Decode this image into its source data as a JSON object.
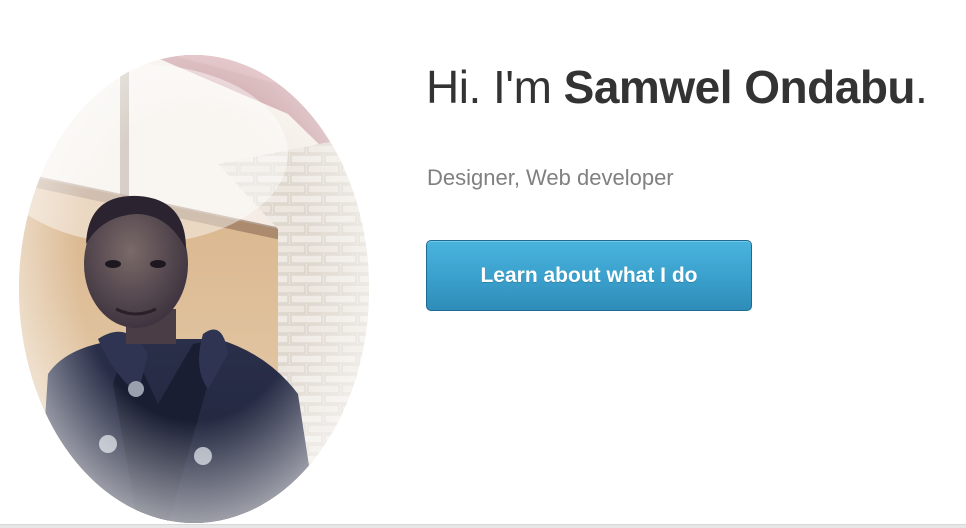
{
  "hero": {
    "greeting": "Hi. I'm ",
    "name": "Samwel Ondabu",
    "period": ".",
    "subtitle": "Designer, Web developer",
    "cta_label": "Learn about what I do"
  },
  "portrait": {
    "shape": "oval"
  },
  "colors": {
    "heading": "#333333",
    "subtitle": "#808080",
    "button": "#3a9fcc",
    "button_text": "#ffffff"
  }
}
